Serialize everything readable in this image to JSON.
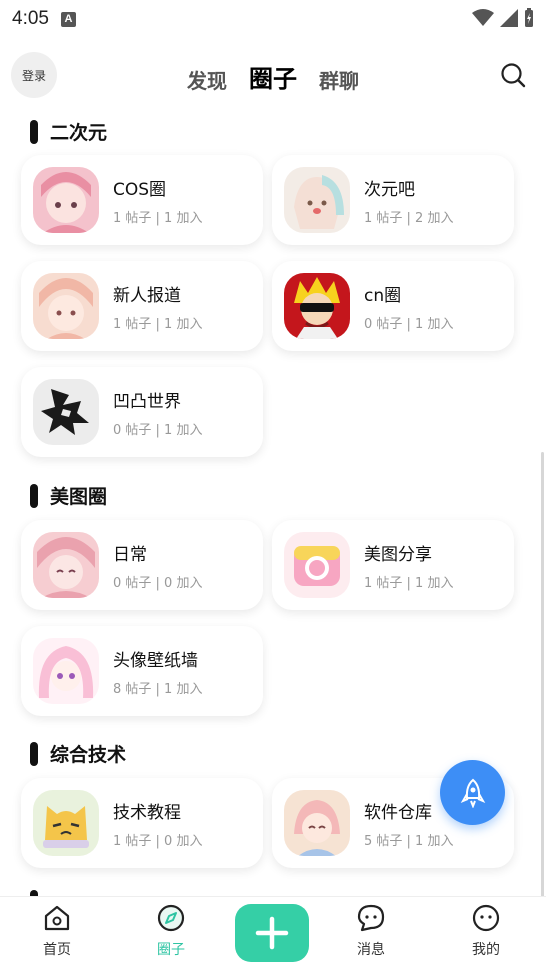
{
  "status_bar": {
    "time": "4:05",
    "a_badge": "A"
  },
  "header": {
    "login_label": "登录",
    "tabs": [
      {
        "label": "发现",
        "active": false
      },
      {
        "label": "圈子",
        "active": true
      },
      {
        "label": "群聊",
        "active": false
      }
    ]
  },
  "sections": [
    {
      "title": "二次元",
      "cards": [
        {
          "name": "COS圈",
          "stats": "1 帖子 | 1 加入"
        },
        {
          "name": "次元吧",
          "stats": "1 帖子 | 2 加入"
        },
        {
          "name": "新人报道",
          "stats": "1 帖子 | 1 加入"
        },
        {
          "name": "cn圈",
          "stats": "0 帖子 | 1 加入"
        },
        {
          "name": "凹凸世界",
          "stats": "0 帖子 | 1 加入"
        }
      ]
    },
    {
      "title": "美图圈",
      "cards": [
        {
          "name": "日常",
          "stats": "0 帖子 | 0 加入"
        },
        {
          "name": "美图分享",
          "stats": "1 帖子 | 1 加入"
        },
        {
          "name": "头像壁纸墙",
          "stats": "8 帖子 | 1 加入"
        }
      ]
    },
    {
      "title": "综合技术",
      "cards": [
        {
          "name": "技术教程",
          "stats": "1 帖子 | 0 加入"
        },
        {
          "name": "软件仓库",
          "stats": "5 帖子 | 1 加入"
        }
      ]
    }
  ],
  "bottom_nav": [
    {
      "label": "首页",
      "icon": "home-icon",
      "active": false
    },
    {
      "label": "圈子",
      "icon": "compass-icon",
      "active": true
    },
    {
      "label": "",
      "icon": "plus-icon",
      "active": false
    },
    {
      "label": "消息",
      "icon": "message-icon",
      "active": false
    },
    {
      "label": "我的",
      "icon": "profile-icon",
      "active": false
    }
  ],
  "colors": {
    "accent": "#35cfa6",
    "active_text": "#2ec4a3",
    "fab": "#3d8ef6"
  }
}
